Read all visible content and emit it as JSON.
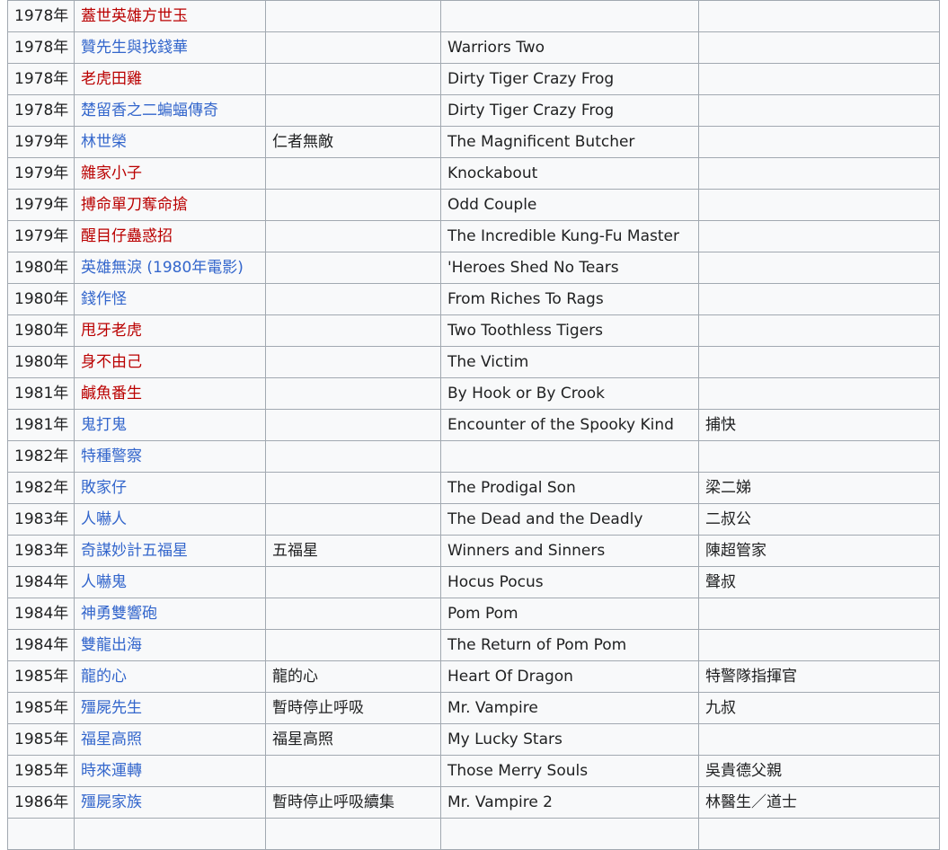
{
  "filmography": {
    "rows": [
      {
        "year": "1978年",
        "title": "蓋世英雄方世玉",
        "redlink": true,
        "alt_title": "",
        "english_title": "",
        "role": ""
      },
      {
        "year": "1978年",
        "title": "贊先生與找錢華",
        "redlink": false,
        "alt_title": "",
        "english_title": "Warriors Two",
        "role": ""
      },
      {
        "year": "1978年",
        "title": "老虎田雞",
        "redlink": true,
        "alt_title": "",
        "english_title": "Dirty Tiger Crazy Frog",
        "role": ""
      },
      {
        "year": "1978年",
        "title": "楚留香之二蝙蝠傳奇",
        "redlink": false,
        "alt_title": "",
        "english_title": "Dirty Tiger Crazy Frog",
        "role": ""
      },
      {
        "year": "1979年",
        "title": "林世榮",
        "redlink": false,
        "alt_title": "仁者無敵",
        "english_title": "The Magnificent Butcher",
        "role": ""
      },
      {
        "year": "1979年",
        "title": "雜家小子",
        "redlink": true,
        "alt_title": "",
        "english_title": "Knockabout",
        "role": ""
      },
      {
        "year": "1979年",
        "title": "搏命單刀奪命搶",
        "redlink": true,
        "alt_title": "",
        "english_title": "Odd Couple",
        "role": ""
      },
      {
        "year": "1979年",
        "title": "醒目仔蠱惑招",
        "redlink": true,
        "alt_title": "",
        "english_title": "The Incredible Kung-Fu Master",
        "role": ""
      },
      {
        "year": "1980年",
        "title": "英雄無淚 (1980年電影)",
        "redlink": false,
        "alt_title": "",
        "english_title": "'Heroes Shed No Tears",
        "role": ""
      },
      {
        "year": "1980年",
        "title": "錢作怪",
        "redlink": false,
        "alt_title": "",
        "english_title": "From Riches To Rags",
        "role": ""
      },
      {
        "year": "1980年",
        "title": "甩牙老虎",
        "redlink": true,
        "alt_title": "",
        "english_title": "Two Toothless Tigers",
        "role": ""
      },
      {
        "year": "1980年",
        "title": "身不由己",
        "redlink": true,
        "alt_title": "",
        "english_title": "The Victim",
        "role": ""
      },
      {
        "year": "1981年",
        "title": "鹹魚番生",
        "redlink": true,
        "alt_title": "",
        "english_title": "By Hook or By Crook",
        "role": ""
      },
      {
        "year": "1981年",
        "title": "鬼打鬼",
        "redlink": false,
        "alt_title": "",
        "english_title": "Encounter of the Spooky Kind",
        "role": "捕快"
      },
      {
        "year": "1982年",
        "title": "特種警察",
        "redlink": false,
        "alt_title": "",
        "english_title": "",
        "role": ""
      },
      {
        "year": "1982年",
        "title": "敗家仔",
        "redlink": false,
        "alt_title": "",
        "english_title": "The Prodigal Son",
        "role": "梁二娣"
      },
      {
        "year": "1983年",
        "title": "人嚇人",
        "redlink": false,
        "alt_title": "",
        "english_title": "The Dead and the Deadly",
        "role": "二叔公"
      },
      {
        "year": "1983年",
        "title": "奇謀妙計五福星",
        "redlink": false,
        "alt_title": "五福星",
        "english_title": "Winners and Sinners",
        "role": "陳超管家"
      },
      {
        "year": "1984年",
        "title": "人嚇鬼",
        "redlink": false,
        "alt_title": "",
        "english_title": "Hocus Pocus",
        "role": "聲叔"
      },
      {
        "year": "1984年",
        "title": "神勇雙響砲",
        "redlink": false,
        "alt_title": "",
        "english_title": "Pom Pom",
        "role": ""
      },
      {
        "year": "1984年",
        "title": "雙龍出海",
        "redlink": false,
        "alt_title": "",
        "english_title": "The Return of Pom Pom",
        "role": ""
      },
      {
        "year": "1985年",
        "title": "龍的心",
        "redlink": false,
        "alt_title": "龍的心",
        "english_title": "Heart Of Dragon",
        "role": "特警隊指揮官"
      },
      {
        "year": "1985年",
        "title": "殭屍先生",
        "redlink": false,
        "alt_title": "暫時停止呼吸",
        "english_title": "Mr. Vampire",
        "role": "九叔"
      },
      {
        "year": "1985年",
        "title": "福星高照",
        "redlink": false,
        "alt_title": "福星高照",
        "english_title": "My Lucky Stars",
        "role": ""
      },
      {
        "year": "1985年",
        "title": "時來運轉",
        "redlink": false,
        "alt_title": "",
        "english_title": "Those Merry Souls",
        "role": "吳貴德父親"
      },
      {
        "year": "1986年",
        "title": "殭屍家族",
        "redlink": false,
        "alt_title": "暫時停止呼吸續集",
        "english_title": "Mr. Vampire 2",
        "role": "林醫生／道士"
      }
    ]
  }
}
